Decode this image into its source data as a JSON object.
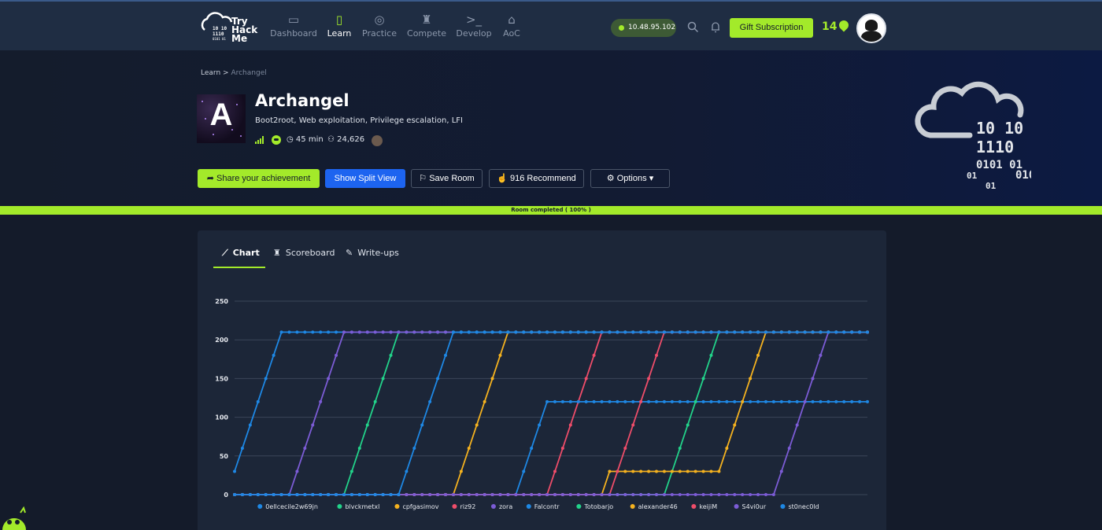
{
  "nav": {
    "logo_text": [
      "Try",
      "Hack",
      "Me"
    ],
    "items": [
      {
        "label": "Dashboard",
        "icon": "dashboard-icon",
        "glyph": "▭",
        "active": false
      },
      {
        "label": "Learn",
        "icon": "book-icon",
        "glyph": "▯",
        "active": true
      },
      {
        "label": "Practice",
        "icon": "target-icon",
        "glyph": "◎",
        "active": false
      },
      {
        "label": "Compete",
        "icon": "trophy-icon",
        "glyph": "♜",
        "active": false
      },
      {
        "label": "Develop",
        "icon": "terminal-icon",
        "glyph": ">_",
        "active": false
      },
      {
        "label": "AoC",
        "icon": "wizard-hat-icon",
        "glyph": "⌂",
        "active": false
      }
    ],
    "ip_address": "10.48.95.102",
    "gift_label": "Gift Subscription",
    "streak": "14"
  },
  "breadcrumb": {
    "parent": "Learn",
    "separator": ">",
    "current": "Archangel"
  },
  "room": {
    "image_letter": "A",
    "title": "Archangel",
    "tags": "Boot2root, Web exploitation, Privilege escalation, LFI",
    "duration": "45 min",
    "users": "24,626"
  },
  "buttons": {
    "share": "Share your achievement",
    "split": "Show Split View",
    "save": "Save Room",
    "recommend": "916 Recommend",
    "options": "Options"
  },
  "progress": {
    "label": "Room completed ( 100% )",
    "percent": 100
  },
  "tabs": [
    {
      "label": "Chart",
      "icon": "chart-icon",
      "active": true
    },
    {
      "label": "Scoreboard",
      "icon": "trophy-icon",
      "active": false
    },
    {
      "label": "Write-ups",
      "icon": "pencil-icon",
      "active": false
    }
  ],
  "chart_data": {
    "type": "line",
    "ylim": [
      0,
      250
    ],
    "yticks": [
      0,
      50,
      100,
      150,
      200,
      250
    ],
    "points": 82,
    "grid": true,
    "legend_position": "bottom",
    "series": [
      {
        "name": "0ellcecile2w69jn",
        "color": "#1e88e5",
        "segments": [
          [
            0,
            30
          ],
          [
            1,
            60
          ],
          [
            2,
            90
          ],
          [
            3,
            120
          ],
          [
            4,
            150
          ],
          [
            5,
            180
          ],
          [
            6,
            210
          ]
        ],
        "final": 210
      },
      {
        "name": "blvckmetxl",
        "color": "#22d38a",
        "segments": [
          [
            0,
            0
          ],
          [
            14,
            0
          ],
          [
            15,
            30
          ],
          [
            16,
            60
          ],
          [
            17,
            90
          ],
          [
            18,
            120
          ],
          [
            19,
            150
          ],
          [
            20,
            180
          ],
          [
            21,
            210
          ]
        ],
        "final": 210
      },
      {
        "name": "cpfgasimov",
        "color": "#f5b21f",
        "segments": [
          [
            0,
            0
          ],
          [
            28,
            0
          ],
          [
            29,
            30
          ],
          [
            30,
            60
          ],
          [
            31,
            90
          ],
          [
            32,
            120
          ],
          [
            33,
            150
          ],
          [
            34,
            180
          ],
          [
            35,
            210
          ]
        ],
        "final": 210
      },
      {
        "name": "riz92",
        "color": "#ef4d6a",
        "segments": [
          [
            0,
            0
          ],
          [
            40,
            0
          ],
          [
            41,
            30
          ],
          [
            42,
            60
          ],
          [
            43,
            90
          ],
          [
            44,
            120
          ],
          [
            45,
            150
          ],
          [
            46,
            180
          ],
          [
            47,
            210
          ]
        ],
        "final": 210
      },
      {
        "name": "zora",
        "color": "#7c5cd6",
        "segments": [
          [
            0,
            0
          ],
          [
            7,
            0
          ],
          [
            8,
            30
          ],
          [
            9,
            60
          ],
          [
            10,
            90
          ],
          [
            11,
            120
          ],
          [
            12,
            150
          ],
          [
            13,
            180
          ],
          [
            14,
            210
          ]
        ],
        "final": 210
      },
      {
        "name": "Falcontr",
        "color": "#1e88e5",
        "segments": [
          [
            0,
            0
          ],
          [
            36,
            0
          ],
          [
            37,
            30
          ],
          [
            38,
            60
          ],
          [
            39,
            90
          ],
          [
            40,
            120
          ]
        ],
        "final": 120
      },
      {
        "name": "Totobarjo",
        "color": "#22d38a",
        "segments": [
          [
            0,
            0
          ],
          [
            55,
            0
          ],
          [
            56,
            30
          ],
          [
            57,
            60
          ],
          [
            58,
            90
          ],
          [
            59,
            120
          ],
          [
            60,
            150
          ],
          [
            61,
            180
          ],
          [
            62,
            210
          ]
        ],
        "final": 210
      },
      {
        "name": "alexander46",
        "color": "#f5b21f",
        "segments": [
          [
            0,
            0
          ],
          [
            47,
            0
          ],
          [
            48,
            30
          ],
          [
            62,
            30
          ],
          [
            63,
            60
          ],
          [
            64,
            90
          ],
          [
            65,
            120
          ],
          [
            66,
            150
          ],
          [
            67,
            180
          ],
          [
            68,
            210
          ]
        ],
        "final": 210
      },
      {
        "name": "keijiM",
        "color": "#ef4d6a",
        "segments": [
          [
            0,
            0
          ],
          [
            48,
            0
          ],
          [
            49,
            30
          ],
          [
            50,
            60
          ],
          [
            51,
            90
          ],
          [
            52,
            120
          ],
          [
            53,
            150
          ],
          [
            54,
            180
          ],
          [
            55,
            210
          ]
        ],
        "final": 210
      },
      {
        "name": "S4vi0ur",
        "color": "#7c5cd6",
        "segments": [
          [
            0,
            0
          ],
          [
            69,
            0
          ],
          [
            70,
            30
          ],
          [
            71,
            60
          ],
          [
            72,
            90
          ],
          [
            73,
            120
          ],
          [
            74,
            150
          ],
          [
            75,
            180
          ],
          [
            76,
            210
          ]
        ],
        "final": 210
      },
      {
        "name": "st0nec0ld",
        "color": "#1e88e5",
        "segments": [
          [
            0,
            0
          ],
          [
            21,
            0
          ],
          [
            22,
            30
          ],
          [
            23,
            60
          ],
          [
            24,
            90
          ],
          [
            25,
            120
          ],
          [
            26,
            150
          ],
          [
            27,
            180
          ],
          [
            28,
            210
          ]
        ],
        "final": 210
      }
    ]
  }
}
